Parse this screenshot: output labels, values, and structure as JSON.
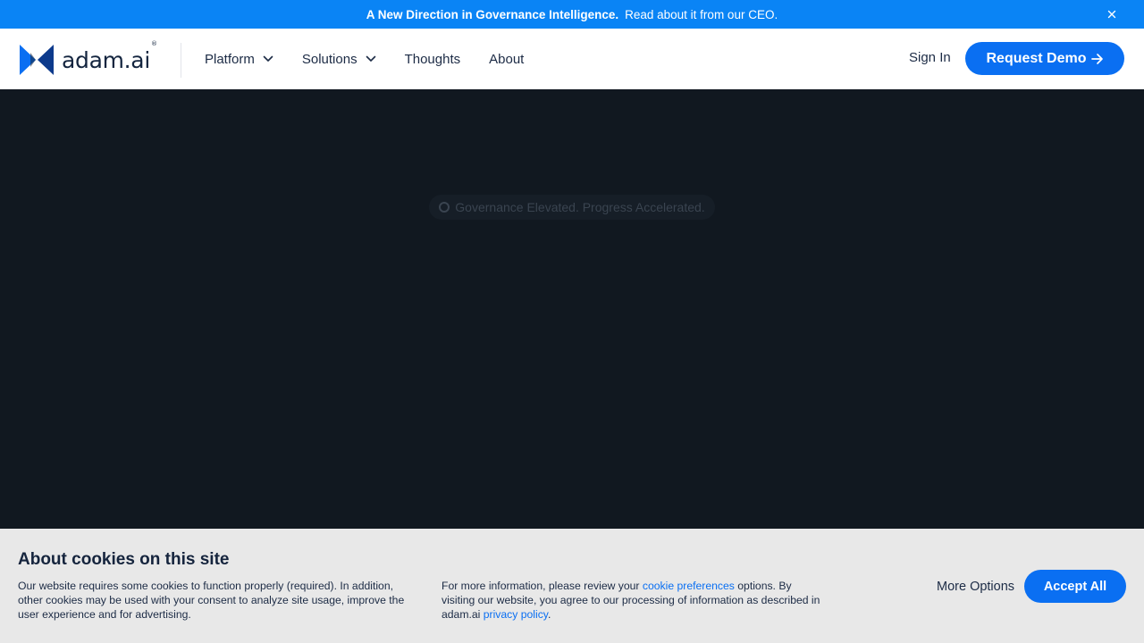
{
  "announcement": {
    "headline": "A New Direction in Governance Intelligence.",
    "link_text": "Read about it from our CEO.",
    "close_icon": "close-icon"
  },
  "nav": {
    "logo_text": "adam.ai",
    "logo_mark": "®",
    "items": [
      {
        "label": "Platform",
        "has_dropdown": true
      },
      {
        "label": "Solutions",
        "has_dropdown": true
      },
      {
        "label": "Thoughts",
        "has_dropdown": false
      },
      {
        "label": "About",
        "has_dropdown": false
      }
    ],
    "sign_in": "Sign In",
    "request_demo": "Request Demo"
  },
  "hero": {
    "tagline": "Governance Elevated. Progress Accelerated."
  },
  "cookie_banner": {
    "title": "About cookies on this site",
    "text_left": "Our website requires some cookies to function properly (required). In addition, other cookies may be used with your consent to analyze site usage, improve the user experience and for advertising.",
    "text_right_before": "For more information, please review your ",
    "cookie_link": "cookie preferences",
    "text_right_middle": " options. By visiting our website, you agree to our processing of information as described in adam.ai ",
    "privacy_link": "privacy policy",
    "text_right_end": ".",
    "more_options": "More Options",
    "accept_all": "Accept All"
  },
  "colors": {
    "brand_blue": "#0a6ff2",
    "announce_blue": "#0a84f5",
    "hero_bg": "#111820",
    "cookie_bg": "#e8e8e8",
    "text_dark": "#1c2b45"
  }
}
